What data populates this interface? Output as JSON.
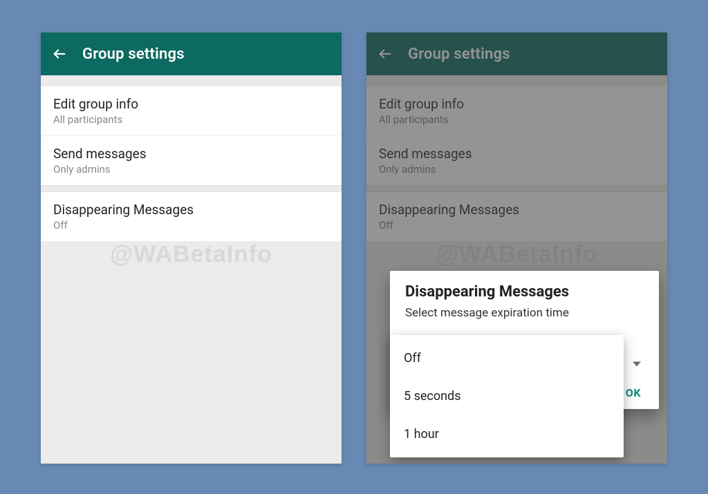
{
  "watermark": "@WABetaInfo",
  "left": {
    "appbar": {
      "title": "Group settings"
    },
    "rows": {
      "editInfo": {
        "primary": "Edit group info",
        "secondary": "All participants"
      },
      "sendMsgs": {
        "primary": "Send messages",
        "secondary": "Only admins"
      },
      "disappear": {
        "primary": "Disappearing Messages",
        "secondary": "Off"
      }
    }
  },
  "right": {
    "appbar": {
      "title": "Group settings"
    },
    "rows": {
      "editInfo": {
        "primary": "Edit group info",
        "secondary": "All participants"
      },
      "sendMsgs": {
        "primary": "Send messages",
        "secondary": "Only admins"
      },
      "disappear": {
        "primary": "Disappearing Messages",
        "secondary": "Off"
      }
    },
    "modal": {
      "title": "Disappearing Messages",
      "subtitle": "Select message expiration time",
      "ok": "OK"
    },
    "options": {
      "opt1": "Off",
      "opt2": "5 seconds",
      "opt3": "1 hour"
    }
  }
}
